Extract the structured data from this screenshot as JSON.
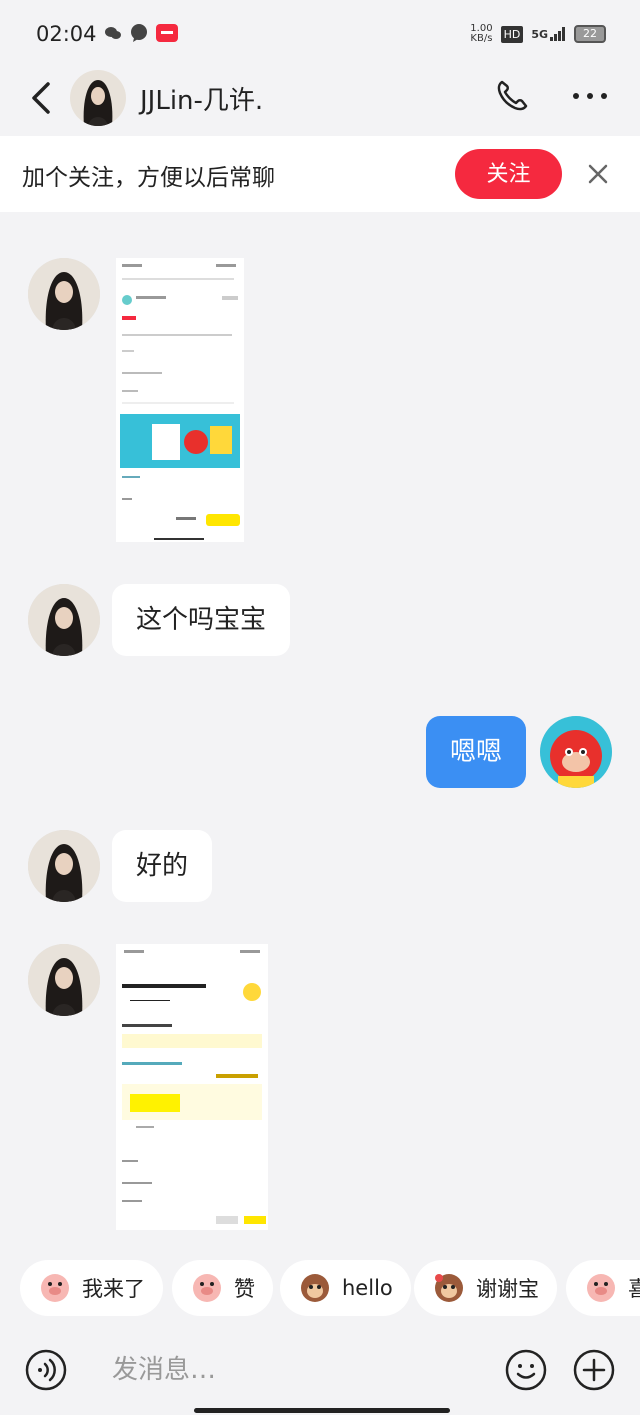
{
  "status_bar": {
    "time": "02:04",
    "net_speed": "1.00\nKB/s",
    "hd": "HD",
    "signal": "5G",
    "battery": "22"
  },
  "header": {
    "contact_name": "JJLin-几许.",
    "back_icon": "chevron-left-icon",
    "call_icon": "phone-icon",
    "more_icon": "more-dots-icon"
  },
  "follow_banner": {
    "text": "加个关注，方便以后常聊",
    "button_label": "关注",
    "close_icon": "close-icon",
    "button_color": "#f5293f"
  },
  "messages": [
    {
      "sender": "them",
      "type": "image",
      "alt": "screenshot"
    },
    {
      "sender": "them",
      "type": "text",
      "text": "这个吗宝宝"
    },
    {
      "sender": "me",
      "type": "text",
      "text": "嗯嗯"
    },
    {
      "sender": "them",
      "type": "text",
      "text": "好的"
    },
    {
      "sender": "them",
      "type": "image",
      "alt": "screenshot"
    }
  ],
  "quick_replies": [
    {
      "label": "我来了",
      "icon": "pig-sticker-icon"
    },
    {
      "label": "赞",
      "icon": "pig-sticker-icon"
    },
    {
      "label": "hello",
      "icon": "monkey-sticker-icon"
    },
    {
      "label": "谢谢宝",
      "icon": "monkey-sticker-icon"
    },
    {
      "label": "喜",
      "icon": "pig-sticker-icon"
    }
  ],
  "input": {
    "placeholder": "发消息…",
    "voice_icon": "voice-icon",
    "emoji_icon": "emoji-icon",
    "plus_icon": "plus-icon"
  },
  "colors": {
    "outgoing_bubble": "#3b8ff3",
    "incoming_bubble": "#ffffff",
    "background": "#f3f3f5"
  }
}
